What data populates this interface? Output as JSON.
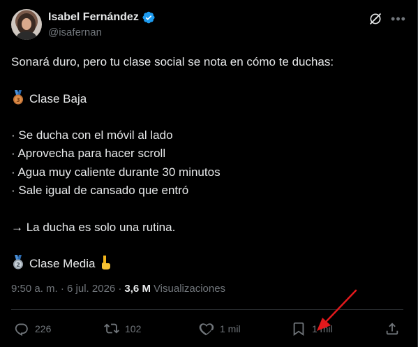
{
  "author": {
    "display_name": "Isabel Fernández",
    "handle": "@isafernan",
    "verified": true
  },
  "icons": {
    "verified": "verified-badge-icon",
    "grok": "grok-icon",
    "more": "more-icon"
  },
  "tweet": {
    "lines": [
      "Sonará duro, pero tu clase social se nota en cómo te duchas:",
      "",
      "Clase Baja",
      "",
      "· Se ducha con el móvil al lado",
      "· Aprovecha para hacer scroll",
      "· Agua muy caliente durante 30 minutos",
      "· Sale igual de cansado que entró",
      "",
      "→ La ducha es solo una rutina.",
      "",
      "Clase Media"
    ],
    "medal_bronze": "3",
    "medal_silver": "2"
  },
  "meta": {
    "timestamp": "9:50 a. m. · 6 jul. 2026 ·",
    "views_count": "3,6 M",
    "views_label": "Visualizaciones"
  },
  "actions": {
    "replies": "226",
    "reposts": "102",
    "likes": "1 mil",
    "bookmarks": "1 mil"
  },
  "colors": {
    "background": "#000000",
    "text": "#e7e9ea",
    "muted": "#71767b",
    "verified": "#1d9bf0",
    "annotation_arrow": "#e3191c"
  }
}
